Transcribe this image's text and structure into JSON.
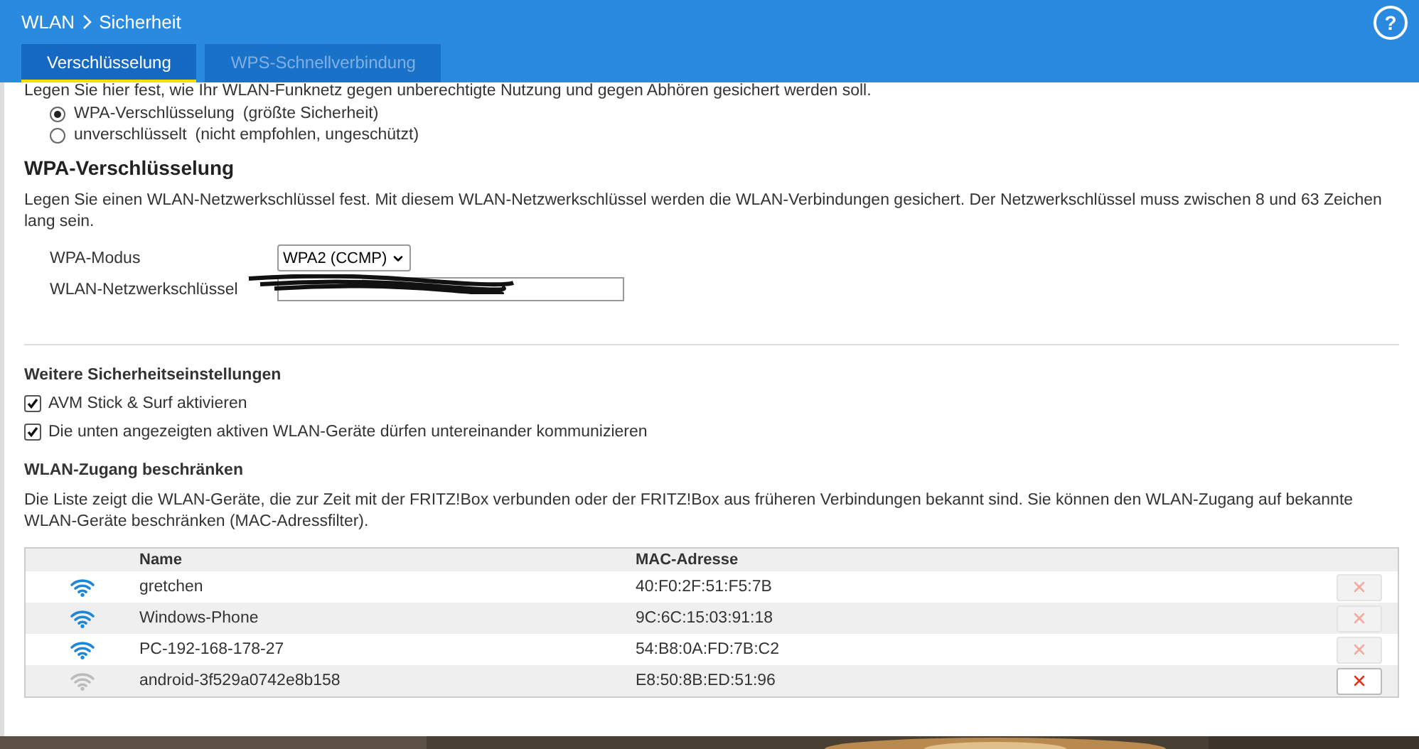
{
  "header": {
    "breadcrumb": [
      "WLAN",
      "Sicherheit"
    ],
    "help": "?"
  },
  "tabs": [
    {
      "label": "Verschlüsselung",
      "selected": true
    },
    {
      "label": "WPS-Schnellverbindung",
      "selected": false
    }
  ],
  "intro": "Legen Sie hier fest, wie Ihr WLAN-Funknetz gegen unberechtigte Nutzung und gegen Abhören gesichert werden soll.",
  "modes": [
    {
      "label": "WPA-Verschlüsselung",
      "note": "(größte Sicherheit)",
      "selected": true
    },
    {
      "label": "unverschlüsselt",
      "note": "(nicht empfohlen, ungeschützt)",
      "selected": false
    }
  ],
  "wpa": {
    "heading": "WPA-Verschlüsselung",
    "description": "Legen Sie einen WLAN-Netzwerkschlüssel fest. Mit diesem WLAN-Netzwerkschlüssel werden die WLAN-Verbindungen gesichert. Der Netzwerkschlüssel muss zwischen 8 und 63 Zeichen lang sein.",
    "mode_label": "WPA-Modus",
    "mode_value": "WPA2 (CCMP)",
    "key_label": "WLAN-Netzwerkschlüssel",
    "key_redacted": true
  },
  "further": {
    "heading": "Weitere Sicherheitseinstellungen",
    "options": [
      {
        "label": "AVM Stick & Surf aktivieren",
        "checked": true
      },
      {
        "label": "Die unten angezeigten aktiven WLAN-Geräte dürfen untereinander kommunizieren",
        "checked": true
      }
    ]
  },
  "access": {
    "heading": "WLAN-Zugang beschränken",
    "description": "Die Liste zeigt die WLAN-Geräte, die zur Zeit mit der FRITZ!Box verbunden oder der FRITZ!Box aus früheren Verbindungen bekannt sind. Sie können den WLAN-Zugang auf bekannte WLAN-Geräte beschränken (MAC-Adressfilter)."
  },
  "table": {
    "columns": [
      "Name",
      "MAC-Adresse"
    ],
    "rows": [
      {
        "name": "gretchen",
        "mac": "40:F0:2F:51:F5:7B",
        "connected": true,
        "delete_disabled": true
      },
      {
        "name": "Windows-Phone",
        "mac": "9C:6C:15:03:91:18",
        "connected": true,
        "delete_disabled": true
      },
      {
        "name": "PC-192-168-178-27",
        "mac": "54:B8:0A:FD:7B:C2",
        "connected": true,
        "delete_disabled": true
      },
      {
        "name": "android-3f529a0742e8b158",
        "mac": "E8:50:8B:ED:51:96",
        "connected": false,
        "delete_disabled": false
      }
    ]
  }
}
